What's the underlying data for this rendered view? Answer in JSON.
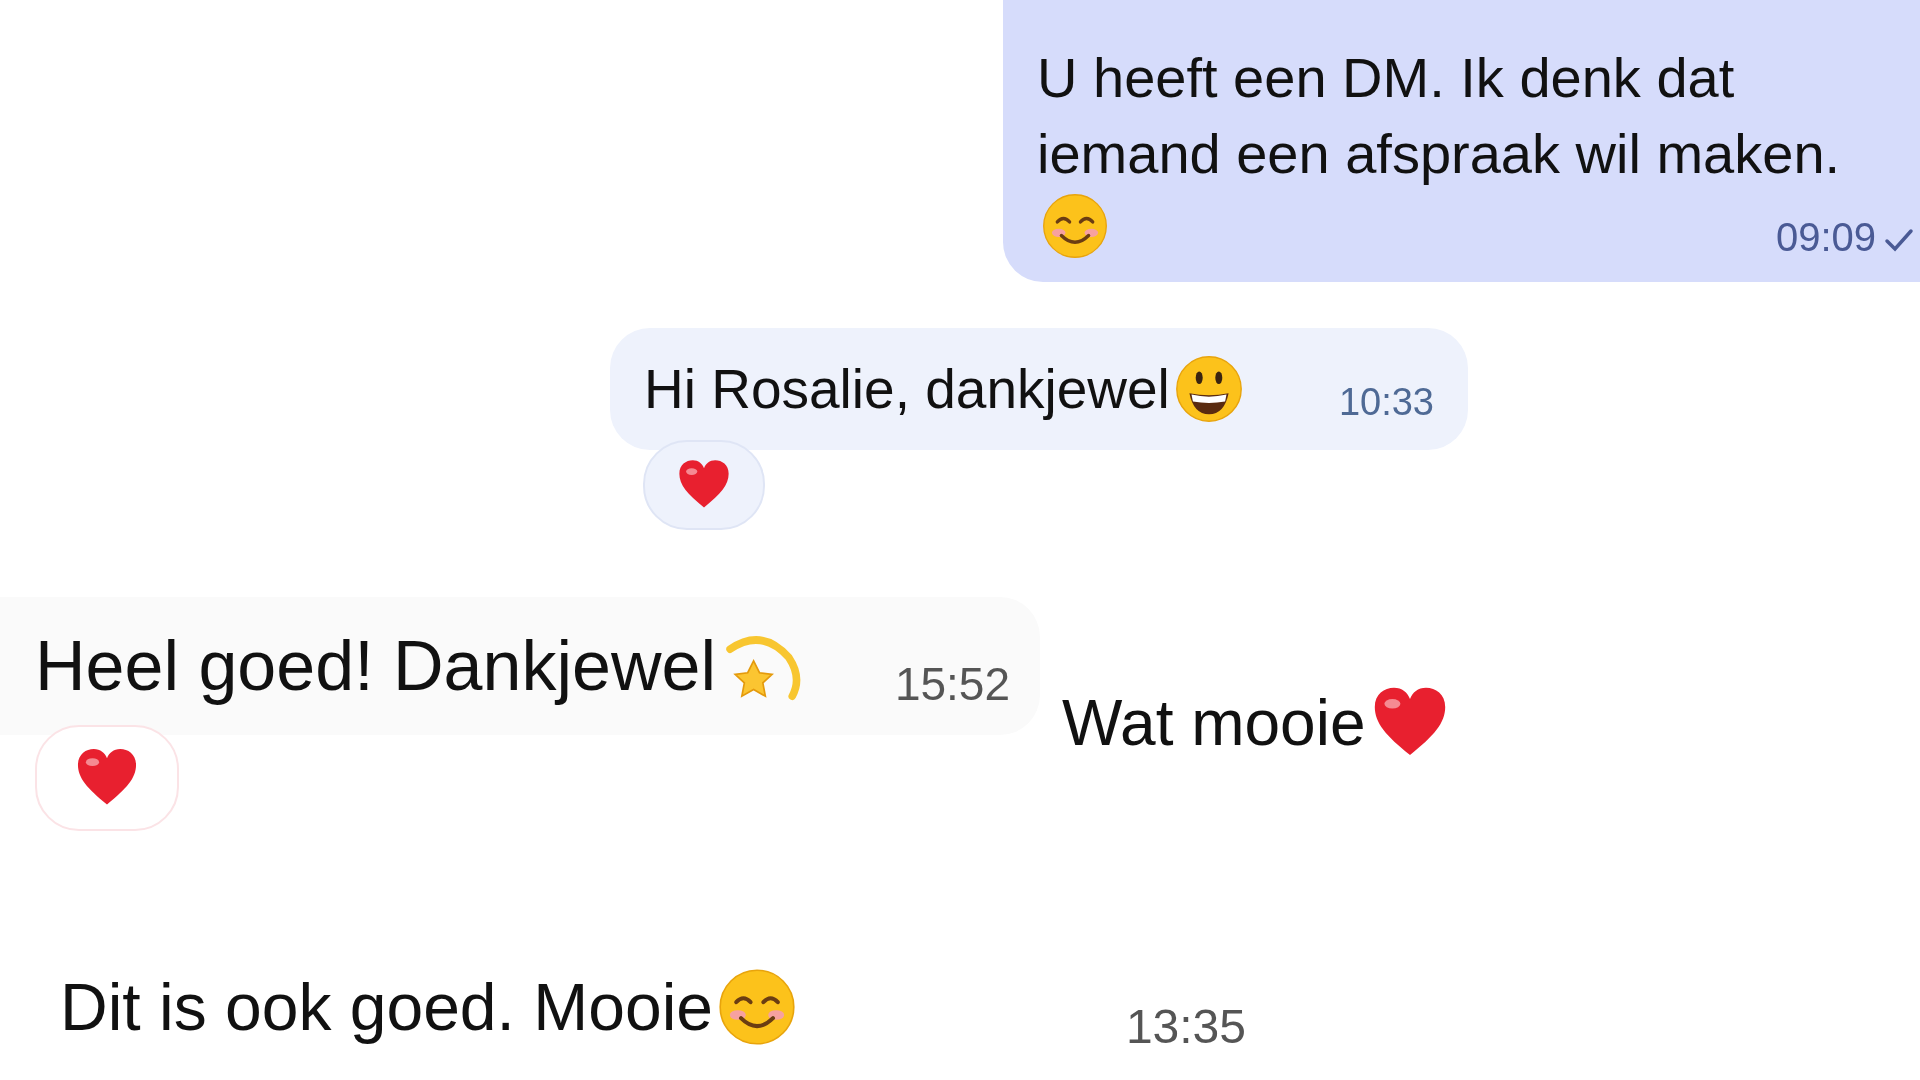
{
  "rows": [
    {
      "kind": "sent",
      "messages": [
        {
          "kind": "sent",
          "text": "U heeft een DM. Ik denk dat",
          "text_2": "iemand een afspraak wil maken.",
          "emoji": {
            "kind": "smile"
          },
          "time": "09:09",
          "read": true
        }
      ]
    },
    {
      "kind": "middle",
      "messages": [
        {
          "kind": "received",
          "text": "Hi Rosalie, dankjewel",
          "emoji": {
            "kind": "grin"
          },
          "time": "10:33",
          "reaction": {
            "kind": "heart"
          }
        }
      ]
    },
    {
      "kind": "left",
      "messages": [
        {
          "kind": "faint",
          "text": "Heel goed! Dankjewel",
          "emoji": {
            "kind": "dizzy"
          },
          "time": "15:52",
          "reaction": {
            "kind": "heart"
          }
        },
        {
          "kind": "plain",
          "text": "Wat mooie",
          "emoji": {
            "kind": "heart"
          }
        }
      ]
    },
    {
      "kind": "bottom",
      "messages": [
        {
          "kind": "plain",
          "text": "Dit is ook goed. Mooie",
          "emoji": {
            "kind": "smile"
          },
          "time": "13:35"
        }
      ]
    }
  ]
}
